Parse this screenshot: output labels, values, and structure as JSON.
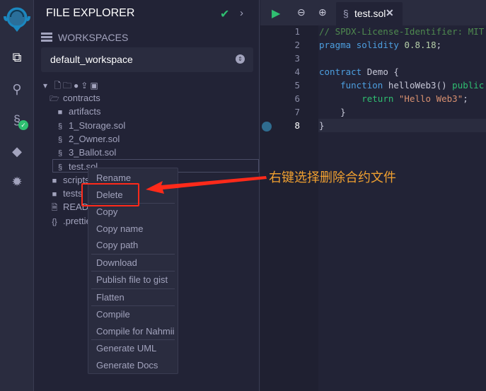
{
  "panel": {
    "title": "FILE EXPLORER",
    "workspaces_label": "WORKSPACES",
    "workspace": "default_workspace"
  },
  "tree": [
    {
      "name": "contracts",
      "type": "folder-open"
    },
    {
      "name": "artifacts",
      "type": "folder"
    },
    {
      "name": "1_Storage.sol",
      "type": "sol"
    },
    {
      "name": "2_Owner.sol",
      "type": "sol"
    },
    {
      "name": "3_Ballot.sol",
      "type": "sol"
    },
    {
      "name": "test.sol",
      "type": "sol"
    },
    {
      "name": "scripts",
      "type": "folder"
    },
    {
      "name": "tests",
      "type": "folder"
    },
    {
      "name": "README.txt",
      "type": "file"
    },
    {
      "name": ".prettierrc.json",
      "type": "json"
    }
  ],
  "context_menu": [
    "Rename",
    "Delete",
    "Copy",
    "Copy name",
    "Copy path",
    "Download",
    "Publish file to gist",
    "Flatten",
    "Compile",
    "Compile for Nahmii",
    "Generate UML",
    "Generate Docs"
  ],
  "editor": {
    "tab": "test.sol",
    "lines": [
      "// SPDX-License-Identifier: MIT",
      "pragma solidity 0.8.18;",
      "",
      "contract Demo {",
      "    function helloWeb3() public",
      "        return \"Hello Web3\";",
      "    }",
      "}"
    ],
    "line_numbers": [
      "1",
      "2",
      "3",
      "4",
      "5",
      "6",
      "7",
      "8"
    ]
  },
  "annotation": "右键选择删除合约文件",
  "colors": {
    "accent": "#2fbf71",
    "highlight": "#ff2a1a",
    "annotation": "#f0a030"
  }
}
